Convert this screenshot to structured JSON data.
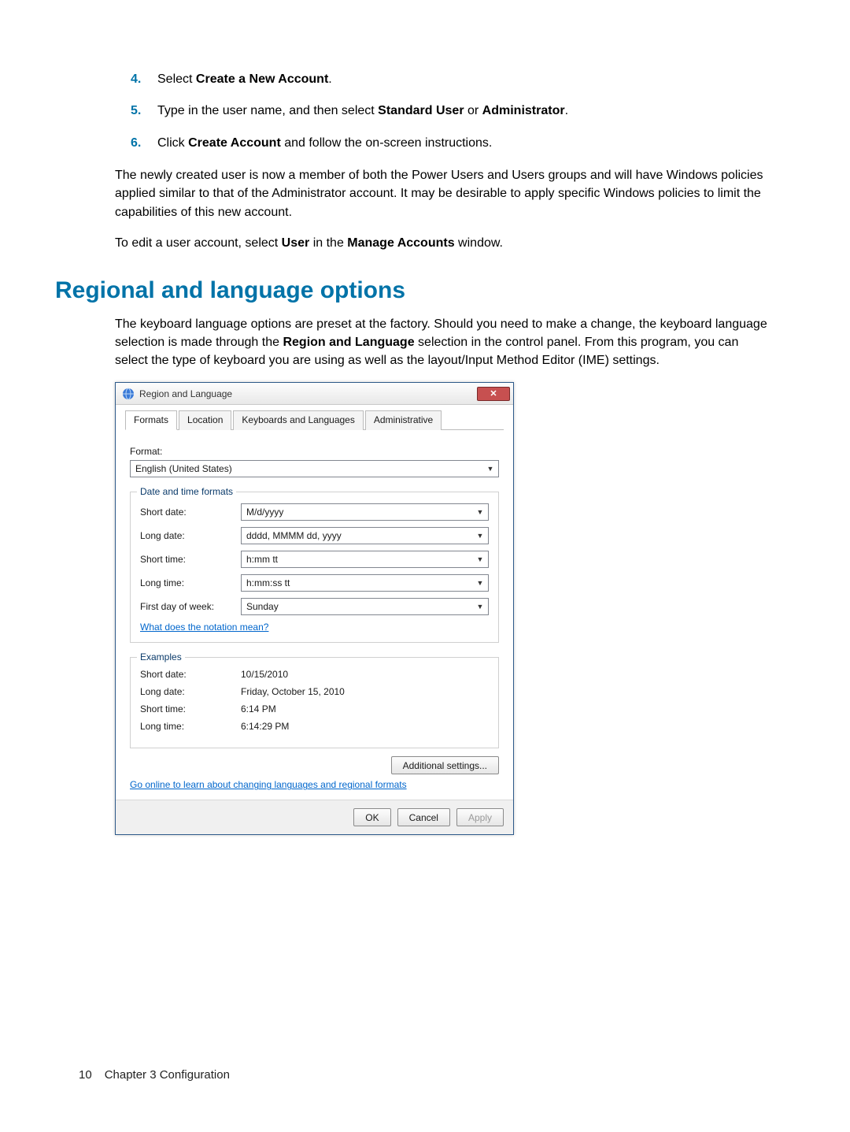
{
  "steps": [
    {
      "num": "4.",
      "pre": "Select ",
      "bold": "Create a New Account",
      "post": "."
    },
    {
      "num": "5.",
      "pre": "Type in the user name, and then select ",
      "bold": "Standard User",
      "mid": " or ",
      "bold2": "Administrator",
      "post": "."
    },
    {
      "num": "6.",
      "pre": "Click ",
      "bold": "Create Account",
      "post": " and follow the on-screen instructions."
    }
  ],
  "para1": "The newly created user is now a member of both the Power Users and Users groups and will have Windows policies applied similar to that of the Administrator account. It may be desirable to apply specific Windows policies to limit the capabilities of this new account.",
  "para2_pre": "To edit a user account, select ",
  "para2_b1": "User",
  "para2_mid": " in the ",
  "para2_b2": "Manage Accounts",
  "para2_post": " window.",
  "section_title": "Regional and language options",
  "para3_pre": "The keyboard language options are preset at the factory. Should you need to make a change, the keyboard language selection is made through the ",
  "para3_b": "Region and Language",
  "para3_post": " selection in the control panel. From this program, you can select the type of keyboard you are using as well as the layout/Input Method Editor (IME) settings.",
  "dialog": {
    "title": "Region and Language",
    "tabs": [
      "Formats",
      "Location",
      "Keyboards and Languages",
      "Administrative"
    ],
    "format_label": "Format:",
    "format_value": "English (United States)",
    "datetime_legend": "Date and time formats",
    "rows": [
      {
        "label": "Short date:",
        "value": "M/d/yyyy"
      },
      {
        "label": "Long date:",
        "value": "dddd, MMMM dd, yyyy"
      },
      {
        "label": "Short time:",
        "value": "h:mm tt"
      },
      {
        "label": "Long time:",
        "value": "h:mm:ss tt"
      },
      {
        "label": "First day of week:",
        "value": "Sunday"
      }
    ],
    "notation_link": "What does the notation mean?",
    "examples_legend": "Examples",
    "examples": [
      {
        "label": "Short date:",
        "value": "10/15/2010"
      },
      {
        "label": "Long date:",
        "value": "Friday, October 15, 2010"
      },
      {
        "label": "Short time:",
        "value": "6:14 PM"
      },
      {
        "label": "Long time:",
        "value": "6:14:29 PM"
      }
    ],
    "additional_btn": "Additional settings...",
    "online_link": "Go online to learn about changing languages and regional formats",
    "ok": "OK",
    "cancel": "Cancel",
    "apply": "Apply"
  },
  "footer": {
    "page": "10",
    "chapter": "Chapter 3   Configuration"
  }
}
